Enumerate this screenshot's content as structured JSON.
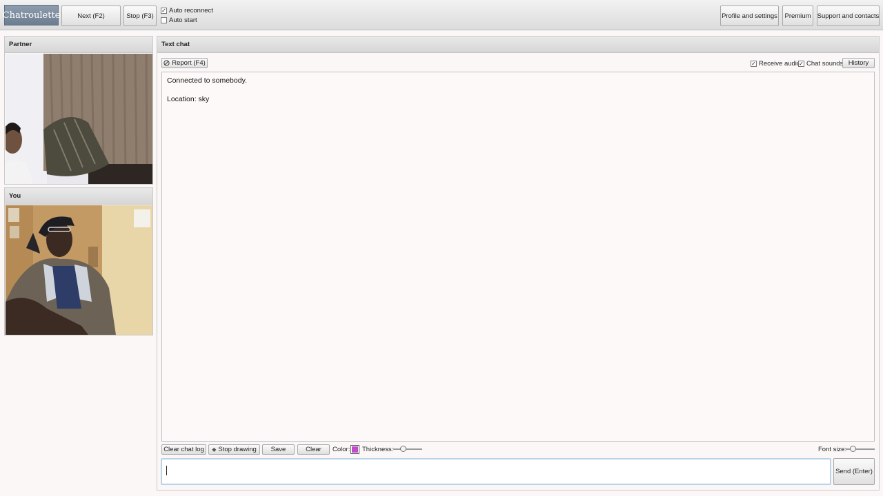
{
  "topbar": {
    "logo": "Chatroulette",
    "next_label": "Next (F2)",
    "stop_label": "Stop (F3)",
    "auto_reconnect": {
      "label": "Auto reconnect",
      "checked": true
    },
    "auto_start": {
      "label": "Auto start",
      "checked": false
    },
    "profile_label": "Profile and settings",
    "premium_label": "Premium",
    "support_label": "Support and contacts"
  },
  "partner": {
    "title": "Partner"
  },
  "you": {
    "title": "You"
  },
  "chat": {
    "title": "Text chat",
    "report_label": "Report (F4)",
    "receive_audio": {
      "label": "Receive audio",
      "checked": true
    },
    "chat_sounds": {
      "label": "Chat sounds",
      "checked": true
    },
    "history_label": "History",
    "messages": [
      "Connected to somebody.",
      "Location: sky"
    ],
    "clear_log_label": "Clear chat log",
    "stop_drawing_label": "Stop drawing",
    "save_label": "Save",
    "clear_label": "Clear",
    "color_label": "Color:",
    "color_value": "#c04ccc",
    "thickness_label": "Thickness:",
    "font_size_label": "Font size:",
    "send_label": "Send (Enter)"
  }
}
